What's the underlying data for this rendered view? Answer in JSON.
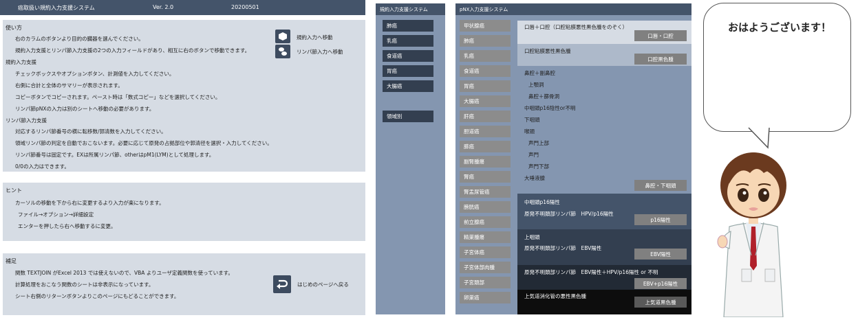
{
  "header": {
    "title": "癌取扱い規約入力支援システム",
    "version": "Ver. 2.0",
    "date": "20200501"
  },
  "usage": {
    "title": "使い方",
    "lines": [
      "右のカラムのボタンより目的の臓器を選んでください。",
      "規約入力支援とリンパ節入力支援の2つの入力フィールドがあり、相互に右のボタンで移動できます。",
      "規約入力支援",
      "チェックボックスやオプションボタン、計測値を入力してください。",
      "右側に合計と全体のサマリーが表示されます。",
      "コピーボタンでコピーされます。ペースト時は「数式コピー」などを選択してください。",
      "リンパ節pNXの入力は別のシートへ移動の必要があります。",
      "リンパ節入力支援",
      "対応するリンパ節番号の横に転移数/郭清数を入力してください。",
      "領域リンパ節の判定を自動でおこないます。必要に応じて原発の占拠部位や郭清径を選択・入力してください。",
      "リンパ節番号は固定です。EXは所属リンパ節、otherはpM1(LYM)として処理します。",
      "0/0の入力はできます。"
    ],
    "link1": "規約入力へ移動",
    "link2": "リンパ節入力へ移動"
  },
  "hint": {
    "title": "ヒント",
    "lines": [
      "カーソルの移動を下から右に変更するより入力が楽になります。",
      "ファイル→オプション→詳細設定",
      "エンターを押したら右へ移動するに変更。"
    ]
  },
  "notes": {
    "title": "補足",
    "lines": [
      "関数 TEXTJOIN がExcel 2013 では使えないので、VBA よりユーザ定義関数を使っています。",
      "計算処理をおこなう関数のシートは非表示になっています。",
      "シート右側のリターンボタンよりこのページにもどることができます。"
    ],
    "return_label": "はじめのページへ戻る"
  },
  "middle": {
    "title": "規約入力支援システム",
    "buttons": [
      "肺癌",
      "乳癌",
      "食道癌",
      "胃癌",
      "大腸癌"
    ],
    "region_button": "領域別"
  },
  "right": {
    "title": "pNX入力支援システム",
    "buttons": [
      "甲状腺癌",
      "肺癌",
      "乳癌",
      "食道癌",
      "胃癌",
      "大腸癌",
      "肝癌",
      "胆道癌",
      "膵癌",
      "副腎腫瘍",
      "腎癌",
      "腎盂尿管癌",
      "膀胱癌",
      "前立腺癌",
      "精巣腫瘍",
      "子宮体癌",
      "子宮体部肉腫",
      "子宮頚部",
      "卵巣癌"
    ],
    "sec1": {
      "label": "口唇＋口腔（口腔粘膜悪性黒色腫をのぞく）",
      "button": "口唇・口腔"
    },
    "sec2": {
      "label": "口腔粘膜悪性黒色腫",
      "button": "口腔黒色腫"
    },
    "sec3": {
      "lines": [
        "鼻腔＋副鼻腔",
        "上顎洞",
        "鼻腔＋篩骨洞",
        "中咽頭p16陰性or不明",
        "下咽頭",
        "喉頭",
        "声門上部",
        "声門",
        "声門下部",
        "大唾液腺"
      ],
      "button": "鼻腔・下咽頭"
    },
    "sec4": {
      "title": "中咽頭p16陽性",
      "label": "原発不明頚部リンパ節　HPV/p16陽性",
      "button": "p16陽性"
    },
    "sec5": {
      "title": "上咽頭",
      "label": "原発不明頚部リンパ節　EBV陽性",
      "button": "EBV陽性"
    },
    "sec6": {
      "label": "原発不明頚部リンパ節　EBV陽性＋HPV/p16陽性 or 不明",
      "button": "EBV+p16陽性"
    },
    "sec7": {
      "label": "上気道消化管の悪性黒色腫",
      "button": "上気道黒色腫"
    }
  },
  "character": {
    "greeting": "おはようございます！"
  }
}
